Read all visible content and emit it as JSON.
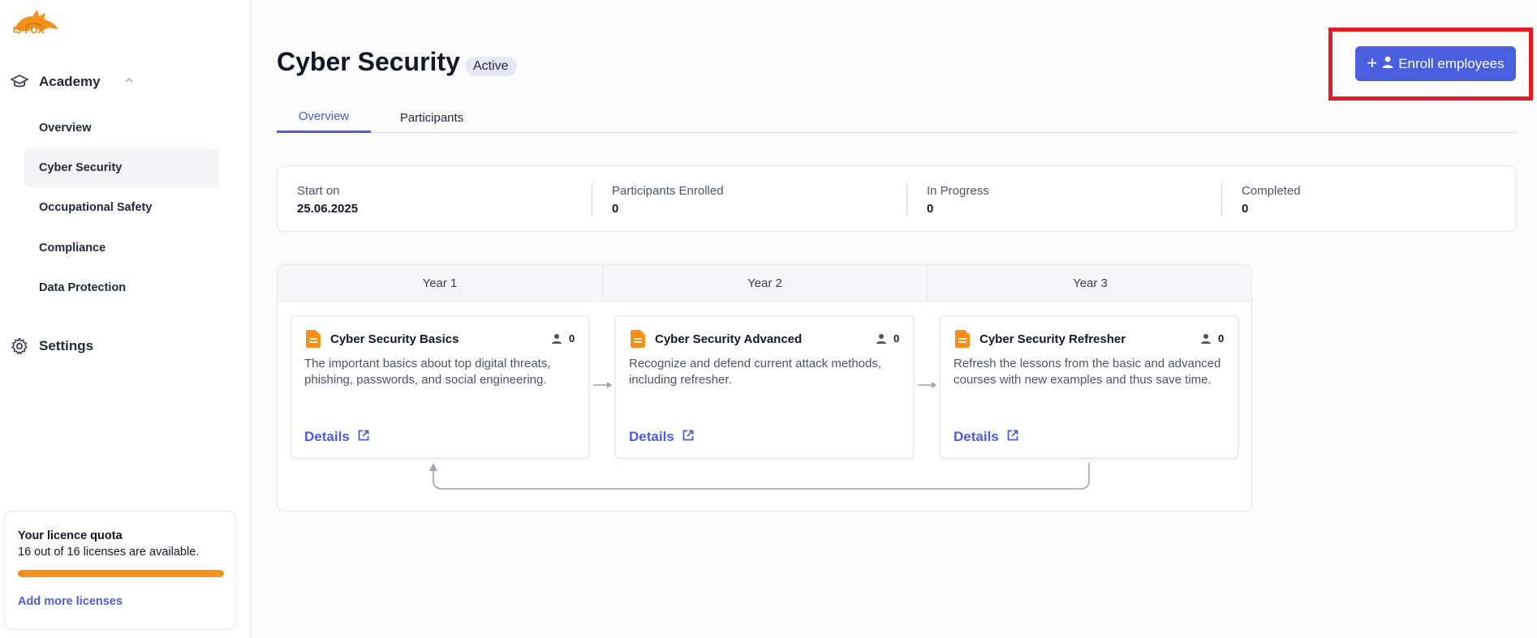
{
  "app": {
    "logo_text": "IS-FOX"
  },
  "sidebar": {
    "group_label": "Academy",
    "items": [
      {
        "label": "Overview"
      },
      {
        "label": "Cyber Security"
      },
      {
        "label": "Occupational Safety"
      },
      {
        "label": "Compliance"
      },
      {
        "label": "Data Protection"
      }
    ],
    "settings_label": "Settings"
  },
  "quota": {
    "title": "Your licence quota",
    "status": "16 out of 16 licenses are available.",
    "progress_fraction": 1.0,
    "add_label": "Add more licenses"
  },
  "header": {
    "title": "Cyber Security",
    "badge": "Active",
    "enroll_label": "Enroll employees"
  },
  "tabs": [
    {
      "label": "Overview"
    },
    {
      "label": "Participants"
    }
  ],
  "stats": [
    {
      "label": "Start on",
      "value": "25.06.2025"
    },
    {
      "label": "Participants Enrolled",
      "value": "0"
    },
    {
      "label": "In Progress",
      "value": "0"
    },
    {
      "label": "Completed",
      "value": "0"
    }
  ],
  "timeline": {
    "years": [
      "Year 1",
      "Year 2",
      "Year 3"
    ],
    "cards": [
      {
        "title": "Cyber Security Basics",
        "count": "0",
        "desc": "The important basics about top digital threats, phishing, passwords, and social engineering.",
        "details": "Details"
      },
      {
        "title": "Cyber Security Advanced",
        "count": "0",
        "desc": "Recognize and defend current attack methods, including refresher.",
        "details": "Details"
      },
      {
        "title": "Cyber Security Refresher",
        "count": "0",
        "desc": "Refresh the lessons from the basic and advanced courses with new examples and thus save time.",
        "details": "Details"
      }
    ]
  },
  "colors": {
    "accent": "#4a5ee0",
    "brand": "#f5901a",
    "highlight": "#e31b23"
  }
}
